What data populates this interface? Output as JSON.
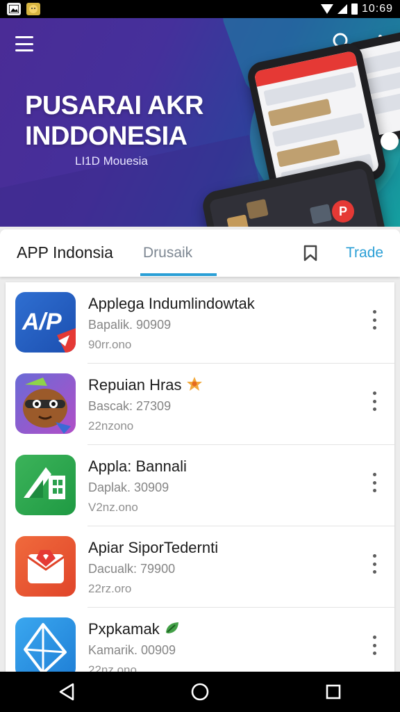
{
  "status_bar": {
    "time": "10:69"
  },
  "hero": {
    "title_line1": "PUSARAI AKR",
    "title_line2": "INDDONESIA",
    "subtitle": "LI1D Mouesia",
    "phone_badge": "P"
  },
  "tabs": {
    "title": "APP Indonsia",
    "active_tab": "Drusaik",
    "trade": "Trade"
  },
  "apps": [
    {
      "name": "Applega Indumlindowtak",
      "meta": "Bapalik. 90909",
      "size": "90rr.ono",
      "icon": "app-logo-red-blue-icon",
      "icon_text": "A/P"
    },
    {
      "name": "Repuian Hras",
      "meta": "Bascak: 27309",
      "size": "22nzono",
      "icon": "cartoon-character-icon",
      "icon_text": ""
    },
    {
      "name": "Appla: Bannali",
      "meta": "Daplak. 30909",
      "size": "V2nz.ono",
      "icon": "green-building-icon",
      "icon_text": ""
    },
    {
      "name": "Apiar SiporTedernti",
      "meta": "Dacualk: 79900",
      "size": "22rz.oro",
      "icon": "red-envelope-heart-icon",
      "icon_text": ""
    },
    {
      "name": "Pxpkamak",
      "meta": "Kamarik. 00909",
      "size": "22nz.ono",
      "icon": "blue-paper-plane-icon",
      "icon_text": ""
    }
  ],
  "colors": {
    "accent": "#2a9fd6",
    "hero_gradient_start": "#4a2c96",
    "hero_gradient_end": "#14a0a0"
  }
}
